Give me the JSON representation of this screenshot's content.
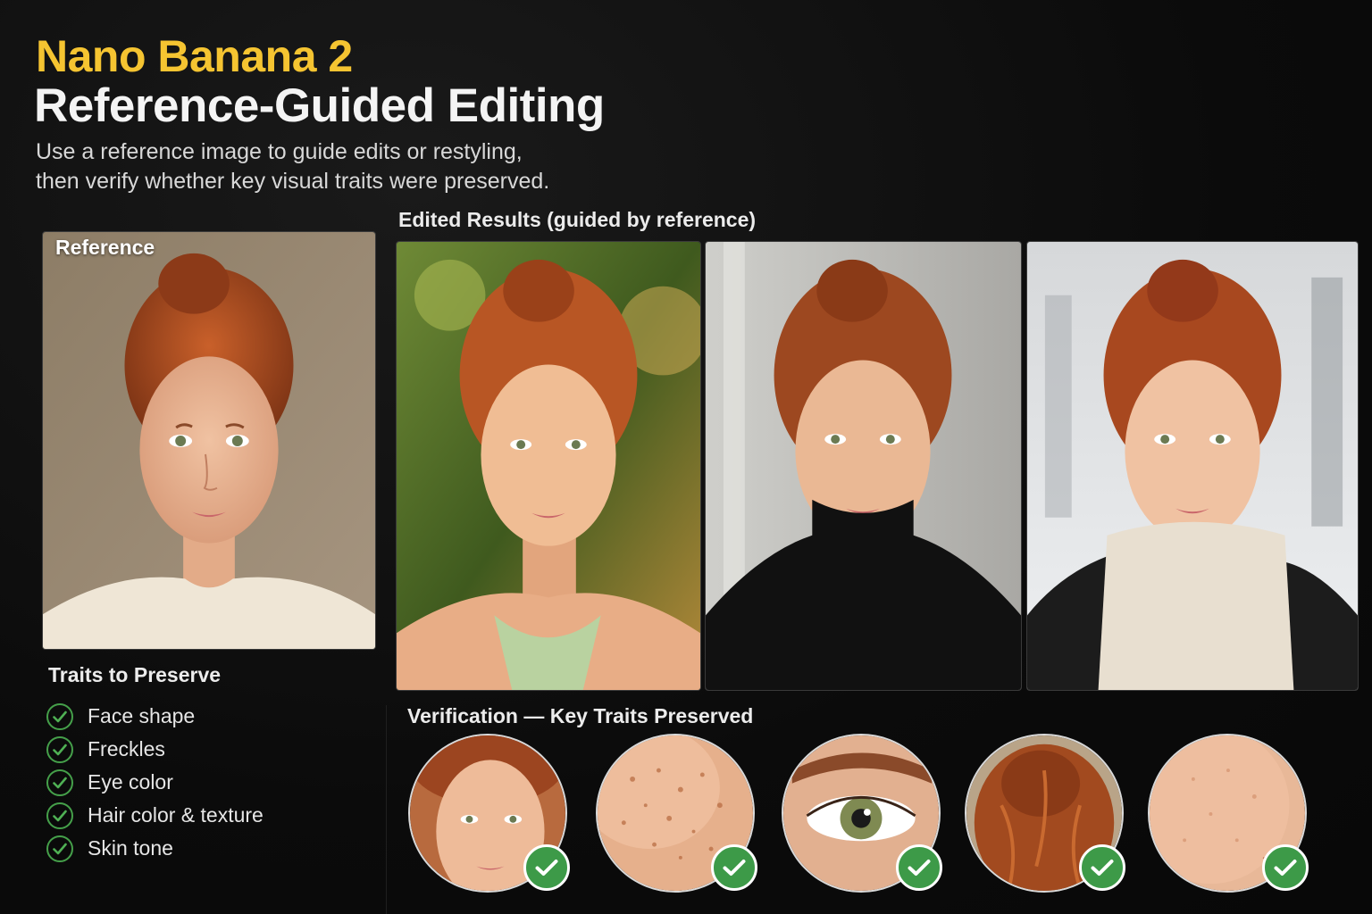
{
  "header": {
    "title_brand": "Nano Banana 2",
    "title_main": "Reference-Guided Editing",
    "subtitle_line1": "Use a reference image to guide edits or restyling,",
    "subtitle_line2": "then verify whether key visual traits were preserved."
  },
  "reference": {
    "label": "Reference",
    "icon": "portrait-image"
  },
  "edited": {
    "heading": "Edited Results (guided by reference)",
    "images": [
      {
        "icon": "portrait-forest-image"
      },
      {
        "icon": "portrait-studio-image"
      },
      {
        "icon": "portrait-snow-image"
      }
    ]
  },
  "traits": {
    "heading": "Traits to Preserve",
    "items": [
      {
        "label": "Face shape",
        "icon": "check-circle-icon"
      },
      {
        "label": "Freckles",
        "icon": "check-circle-icon"
      },
      {
        "label": "Eye color",
        "icon": "check-circle-icon"
      },
      {
        "label": "Hair color & texture",
        "icon": "check-circle-icon"
      },
      {
        "label": "Skin tone",
        "icon": "check-circle-icon"
      }
    ]
  },
  "verification": {
    "heading": "Verification — Key Traits Preserved",
    "crops": [
      {
        "icon": "face-crop"
      },
      {
        "icon": "freckles-crop"
      },
      {
        "icon": "eye-crop"
      },
      {
        "icon": "hair-crop"
      },
      {
        "icon": "skin-crop"
      }
    ],
    "badge_icon": "check-badge-icon"
  },
  "colors": {
    "accent_yellow": "#f5c431",
    "check_green": "#3d9a48",
    "background": "#0d0d0d"
  }
}
